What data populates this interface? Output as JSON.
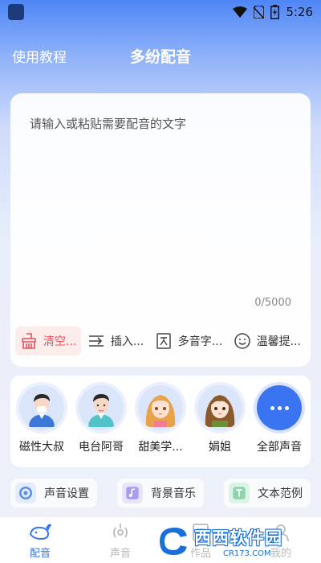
{
  "status_bar": {
    "time": "5:26"
  },
  "header": {
    "tutorial_label": "使用教程",
    "title": "多纷配音"
  },
  "editor": {
    "placeholder": "请输入或粘贴需要配音的文字",
    "counter": "0/5000",
    "tools": [
      {
        "label": "清空...",
        "icon": "broom-icon",
        "active": true
      },
      {
        "label": "插入...",
        "icon": "insert-icon"
      },
      {
        "label": "多音字...",
        "icon": "polyphone-icon"
      },
      {
        "label": "温馨提...",
        "icon": "smile-icon"
      }
    ]
  },
  "voices": [
    {
      "name": "磁性大叔",
      "icon": "male-avatar-icon"
    },
    {
      "name": "电台阿哥",
      "icon": "male-avatar-icon"
    },
    {
      "name": "甜美学...",
      "icon": "anime-girl-avatar-icon"
    },
    {
      "name": "娟姐",
      "icon": "anime-girl-avatar-icon"
    },
    {
      "name": "全部声音",
      "icon": "more-icon"
    }
  ],
  "settings": [
    {
      "label": "声音设置",
      "icon": "voice-settings-icon"
    },
    {
      "label": "背景音乐",
      "icon": "music-icon"
    },
    {
      "label": "文本范例",
      "icon": "text-sample-icon"
    }
  ],
  "nav": [
    {
      "label": "配音",
      "icon": "whale-icon",
      "active": true
    },
    {
      "label": "声音",
      "icon": "sound-icon"
    },
    {
      "label": "作品",
      "icon": "works-icon"
    },
    {
      "label": "我的",
      "icon": "profile-icon"
    }
  ],
  "watermark": {
    "main": "西西软件园",
    "sub": "CR173.COM"
  },
  "colors": {
    "accent": "#3a74f0",
    "danger": "#e8505b"
  }
}
